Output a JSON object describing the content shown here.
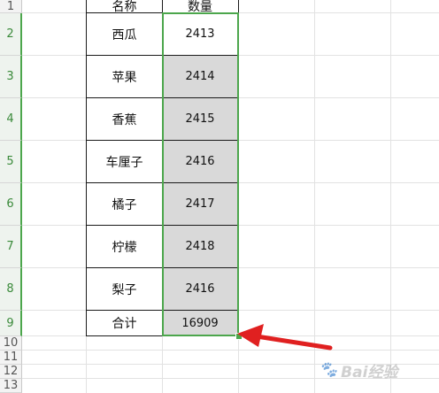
{
  "columns": {
    "name_header": "名称",
    "qty_header": "数量"
  },
  "rows": [
    {
      "row": "2",
      "name": "西瓜",
      "qty": "2413",
      "gray": false
    },
    {
      "row": "3",
      "name": "苹果",
      "qty": "2414",
      "gray": true
    },
    {
      "row": "4",
      "name": "香蕉",
      "qty": "2415",
      "gray": true
    },
    {
      "row": "5",
      "name": "车厘子",
      "qty": "2416",
      "gray": true
    },
    {
      "row": "6",
      "name": "橘子",
      "qty": "2417",
      "gray": true
    },
    {
      "row": "7",
      "name": "柠檬",
      "qty": "2418",
      "gray": true
    },
    {
      "row": "8",
      "name": "梨子",
      "qty": "2416",
      "gray": true
    }
  ],
  "total": {
    "row": "9",
    "label": "合计",
    "value": "16909"
  },
  "extra_rows": [
    "10",
    "11",
    "12",
    "13"
  ],
  "header_row": "1",
  "watermark_text": "Bai经验",
  "colors": {
    "selection": "#4ca64c",
    "arrow": "#e02020",
    "gray_fill": "#d9d9d9"
  }
}
